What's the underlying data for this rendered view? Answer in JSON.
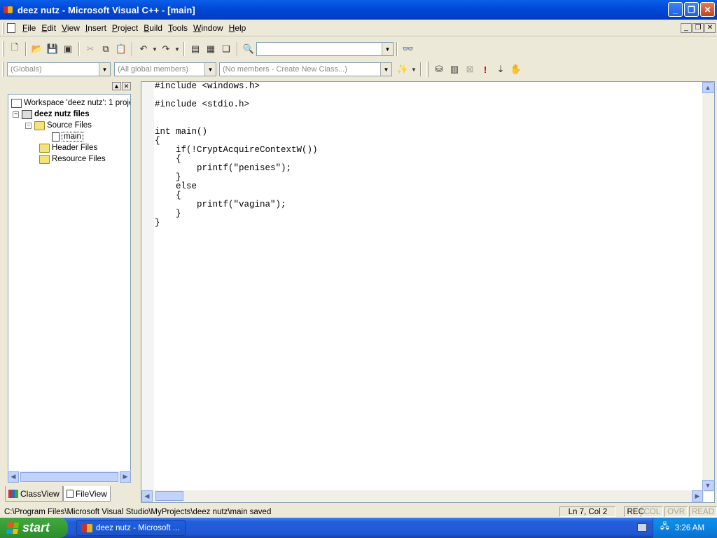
{
  "window": {
    "title": "deez nutz - Microsoft Visual C++ - [main]",
    "minimize": "_",
    "maximize": "❐",
    "close": "✕"
  },
  "menu": {
    "items": [
      {
        "label": "File",
        "key": "F",
        "rest": "ile"
      },
      {
        "label": "Edit",
        "key": "E",
        "rest": "dit"
      },
      {
        "label": "View",
        "key": "V",
        "rest": "iew"
      },
      {
        "label": "Insert",
        "key": "I",
        "rest": "nsert"
      },
      {
        "label": "Project",
        "key": "P",
        "rest": "roject"
      },
      {
        "label": "Build",
        "key": "B",
        "rest": "uild"
      },
      {
        "label": "Tools",
        "key": "T",
        "rest": "ools"
      },
      {
        "label": "Window",
        "key": "W",
        "rest": "indow"
      },
      {
        "label": "Help",
        "key": "H",
        "rest": "elp"
      }
    ]
  },
  "toolbar1": {
    "find_combo_value": ""
  },
  "toolbar2": {
    "globals_combo": "(Globals)",
    "members_combo": "(All global members)",
    "class_combo": "(No members - Create New Class...)"
  },
  "workspace": {
    "root": "Workspace 'deez nutz': 1 proje",
    "project": "deez nutz files",
    "source_folder": "Source Files",
    "source_file": "main",
    "header_folder": "Header Files",
    "resource_folder": "Resource Files",
    "tab_classview": "ClassView",
    "tab_fileview": "FileView"
  },
  "editor": {
    "lines": [
      "#include <windows.h>",
      "",
      "#include <stdio.h>",
      "",
      "",
      "int main()",
      "{",
      "    if(!CryptAcquireContextW())",
      "    {",
      "        printf(\"penises\");",
      "    }",
      "    else",
      "    {",
      "        printf(\"vagina\");",
      "    }",
      "}"
    ]
  },
  "status": {
    "message": "C:\\Program Files\\Microsoft Visual Studio\\MyProjects\\deez nutz\\main saved",
    "position": "Ln 7, Col 2",
    "rec": "REC",
    "col": "COL",
    "ovr": "OVR",
    "read": "READ"
  },
  "taskbar": {
    "start_label": "start",
    "task_label": "deez nutz - Microsoft ...",
    "clock": "3:26 AM"
  },
  "colors": {
    "title_blue": "#0049d8",
    "start_green": "#36a034",
    "editor_bg": "#ffffff"
  }
}
